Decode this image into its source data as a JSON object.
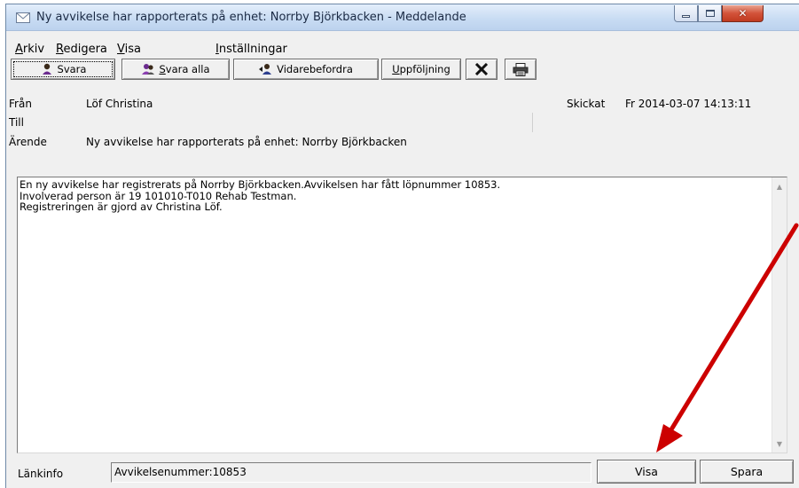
{
  "window": {
    "title": "Ny avvikelse har rapporterats på enhet: Norrby Björkbacken - Meddelande"
  },
  "menu": [
    {
      "label": "Arkiv"
    },
    {
      "label": "Redigera"
    },
    {
      "label": "Visa"
    },
    {
      "label": "Inställningar"
    }
  ],
  "toolbar": {
    "reply": "Svara",
    "reply_all": "Svara alla",
    "forward": "Vidarebefordra",
    "followup": "Uppföljning"
  },
  "header": {
    "from_label": "Från",
    "from_value": "Löf Christina",
    "sent_label": "Skickat",
    "sent_value": "Fr 2014-03-07 14:13:11",
    "to_label": "Till",
    "to_value": "",
    "subject_label": "Ärende",
    "subject_value": "Ny avvikelse har rapporterats på enhet: Norrby Björkbacken"
  },
  "message": {
    "lines": [
      "En ny avvikelse har registrerats på Norrby Björkbacken.Avvikelsen har fått löpnummer 10853.",
      "Involverad person är 19 101010-T010 Rehab Testman.",
      "Registreringen är gjord av Christina Löf."
    ]
  },
  "footer": {
    "link_label": "Länkinfo",
    "link_value": "Avvikelsenummer:10853",
    "show_button": "Visa",
    "save_button": "Spara"
  },
  "colors": {
    "annotation_arrow": "#cc0000",
    "window_bg": "#f0f0f0",
    "close_button": "#c8452c"
  }
}
